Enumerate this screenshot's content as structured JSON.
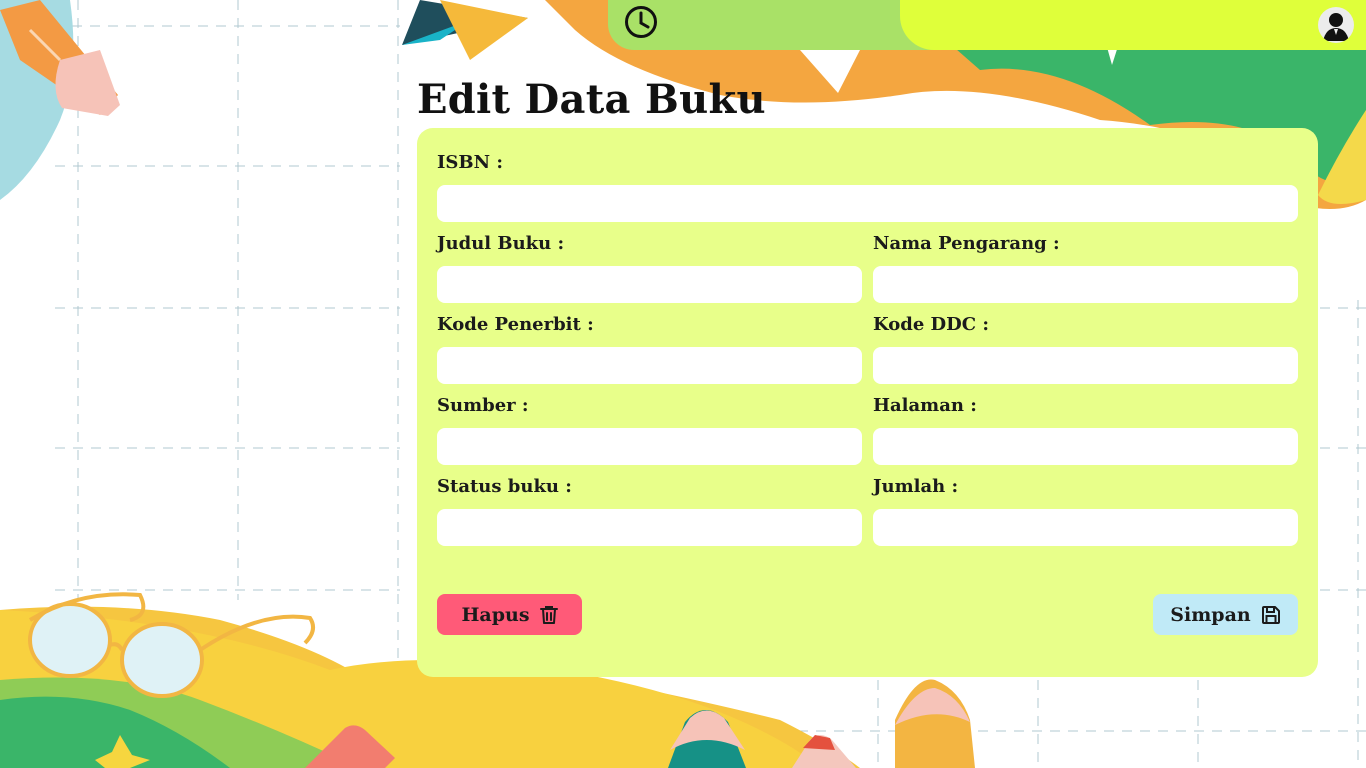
{
  "header": {
    "clock_icon": "clock-icon",
    "avatar_icon": "user-avatar-icon",
    "colors": {
      "green": "#a9e167",
      "lime": "#dfff3a"
    }
  },
  "page": {
    "title": "Edit Data Buku"
  },
  "form": {
    "background": "#e8ff8a",
    "fields": {
      "isbn": {
        "label": "ISBN :",
        "value": "",
        "placeholder": ""
      },
      "judul": {
        "label": "Judul Buku :",
        "value": "",
        "placeholder": ""
      },
      "pengarang": {
        "label": "Nama Pengarang :",
        "value": "",
        "placeholder": ""
      },
      "penerbit": {
        "label": "Kode Penerbit :",
        "value": "",
        "placeholder": ""
      },
      "ddc": {
        "label": "Kode DDC :",
        "value": "",
        "placeholder": ""
      },
      "sumber": {
        "label": "Sumber :",
        "value": "",
        "placeholder": ""
      },
      "halaman": {
        "label": "Halaman :",
        "value": "",
        "placeholder": ""
      },
      "status": {
        "label": "Status buku :",
        "value": "",
        "placeholder": ""
      },
      "jumlah": {
        "label": "Jumlah :",
        "value": "",
        "placeholder": ""
      }
    },
    "delete_button": {
      "label": "Hapus",
      "icon": "trash-icon",
      "color": "#ff5a78"
    },
    "save_button": {
      "label": "Simpan",
      "icon": "save-icon",
      "color": "#c0eaf7"
    }
  }
}
